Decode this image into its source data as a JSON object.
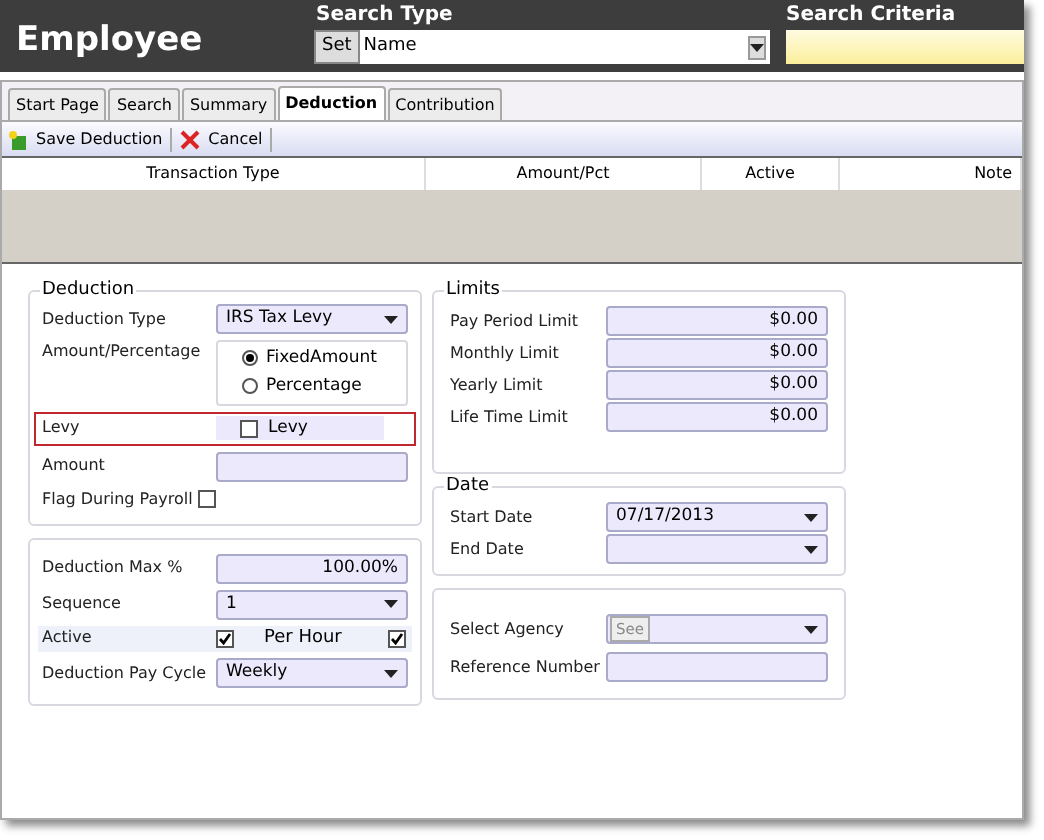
{
  "header": {
    "title": "Employee",
    "search_type": {
      "label": "Search Type",
      "button": "Set",
      "value": "Name"
    },
    "search_criteria": {
      "label": "Search Criteria"
    }
  },
  "tabs": [
    {
      "label": "Start Page",
      "selected": false
    },
    {
      "label": "Search",
      "selected": false
    },
    {
      "label": "Summary",
      "selected": false
    },
    {
      "label": "Deduction",
      "selected": true
    },
    {
      "label": "Contribution",
      "selected": false
    }
  ],
  "toolbar": [
    {
      "label": "Save Deduction",
      "kind": "save"
    },
    {
      "label": "Cancel",
      "kind": "cancel"
    }
  ],
  "table": {
    "columns": [
      "Transaction Type",
      "Amount/Pct",
      "Active",
      "Note"
    ]
  },
  "deduction": {
    "title": "Deduction",
    "deduction_type": {
      "label": "Deduction Type",
      "value": "IRS Tax Levy"
    },
    "amount_percentage": {
      "label": "Amount/Percentage",
      "options": [
        {
          "label": "FixedAmount",
          "selected": true
        },
        {
          "label": "Percentage",
          "selected": false
        }
      ]
    },
    "levy": {
      "label": "Levy",
      "checkbox_label": "Levy",
      "checked": false,
      "highlighted": true
    },
    "amount": {
      "label": "Amount"
    },
    "flag_during_payroll": {
      "label": "Flag During Payroll",
      "checked": false
    }
  },
  "settings": {
    "deduction_max": {
      "label": "Deduction Max %",
      "value": "100.00%"
    },
    "sequence": {
      "label": "Sequence",
      "value": "1"
    },
    "active": {
      "label": "Active",
      "checked": true
    },
    "per_hour": {
      "label": "Per Hour",
      "checked": true
    },
    "pay_cycle": {
      "label": "Deduction Pay Cycle",
      "value": "Weekly"
    }
  },
  "limits": {
    "title": "Limits",
    "rows": [
      {
        "label": "Pay Period Limit",
        "value": "$0.00"
      },
      {
        "label": "Monthly Limit",
        "value": "$0.00"
      },
      {
        "label": "Yearly Limit",
        "value": "$0.00"
      },
      {
        "label": "Life Time Limit",
        "value": "$0.00"
      }
    ]
  },
  "date": {
    "title": "Date",
    "start_date": {
      "label": "Start Date",
      "value": "07/17/2013"
    },
    "end_date": {
      "label": "End Date"
    }
  },
  "agency": {
    "select_agency": {
      "label": "Select Agency",
      "button": "See"
    },
    "reference_number": {
      "label": "Reference Number"
    }
  }
}
